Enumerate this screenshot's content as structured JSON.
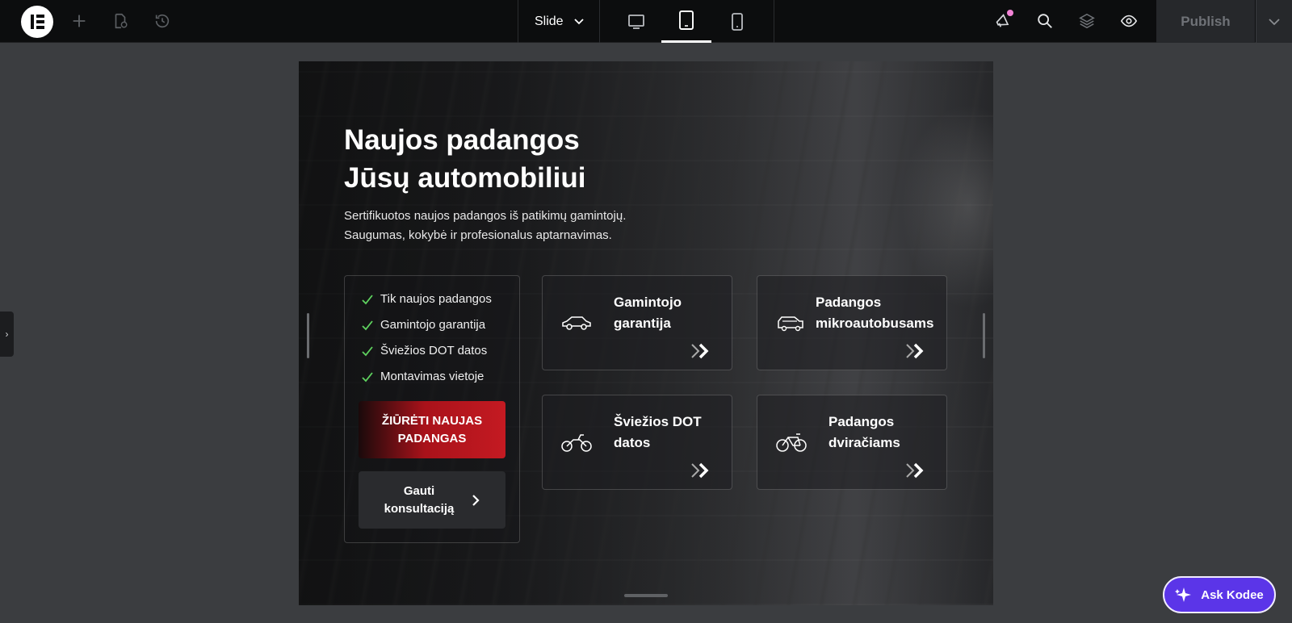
{
  "toolbar": {
    "slide_label": "Slide",
    "publish_label": "Publish",
    "icons": [
      "elementor-logo-icon",
      "add-icon",
      "page-settings-icon",
      "history-icon",
      "chevron-down-icon",
      "desktop-icon",
      "tablet-icon",
      "mobile-icon",
      "announcement-icon",
      "search-icon",
      "layers-icon",
      "preview-eye-icon"
    ]
  },
  "hero": {
    "title_line1": "Naujos padangos",
    "title_line2": "Jūsų automobiliui",
    "subtitle_line1": "Sertifikuotos naujos padangos iš patikimų gamintojų.",
    "subtitle_line2": "Saugumas, kokybė ir profesionalus aptarnavimas."
  },
  "features": {
    "items": [
      "Tik naujos padangos",
      "Gamintojo garantija",
      "Šviežios DOT datos",
      "Montavimas vietoje"
    ],
    "primary_line1": "ŽIŪRĖTI NAUJAS",
    "primary_line2": "PADANGAS",
    "secondary_line1": "Gauti",
    "secondary_line2": "konsultaciją"
  },
  "cards": [
    {
      "line1": "Gamintojo",
      "line2": "garantija",
      "icon": "car-icon"
    },
    {
      "line1": "Padangos",
      "line2": "mikroautobusams",
      "icon": "van-icon"
    },
    {
      "line1": "Šviežios DOT",
      "line2": "datos",
      "icon": "motorcycle-icon"
    },
    {
      "line1": "Padangos",
      "line2": "dviračiams",
      "icon": "bicycle-icon"
    }
  ],
  "assistant": {
    "label": "Ask Kodee"
  },
  "colors": {
    "accent_red": "#c41a22",
    "assistant_purple": "#5b35e8",
    "check_green": "#5fd35f",
    "notif_pink": "#f283d6"
  }
}
